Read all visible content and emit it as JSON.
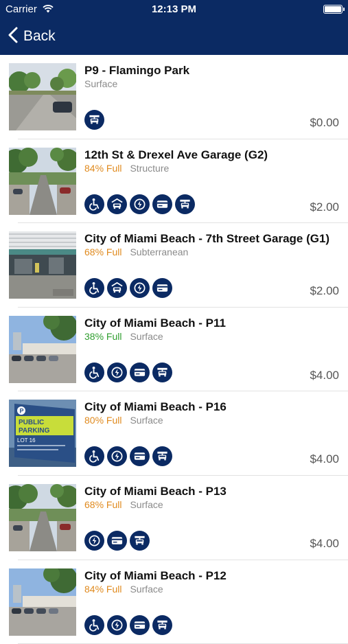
{
  "status_bar": {
    "carrier": "Carrier",
    "time": "12:13 PM"
  },
  "nav": {
    "back_label": "Back"
  },
  "colors": {
    "header": "#0b2a63",
    "orange": "#e08a1e",
    "green": "#2f9e2f",
    "gray": "#8a8a8a"
  },
  "lots": [
    {
      "title": "P9 - Flamingo Park",
      "occupancy": "",
      "occupancy_color": "",
      "type": "Surface",
      "price": "$0.00",
      "amenities": [
        "valet-icon"
      ],
      "photo": "surface-street"
    },
    {
      "title": "12th St & Drexel Ave Garage (G2)",
      "occupancy": "84% Full",
      "occupancy_color": "orange",
      "type": "Structure",
      "price": "$2.00",
      "amenities": [
        "accessible-icon",
        "covered-parking-icon",
        "ev-charging-icon",
        "credit-card-icon",
        "valet-icon"
      ],
      "photo": "tree-street"
    },
    {
      "title": "City of Miami Beach - 7th Street Garage (G1)",
      "occupancy": "68% Full",
      "occupancy_color": "orange",
      "type": "Subterranean",
      "price": "$2.00",
      "amenities": [
        "accessible-icon",
        "covered-parking-icon",
        "ev-charging-icon",
        "credit-card-icon"
      ],
      "photo": "garage"
    },
    {
      "title": "City of Miami Beach - P11",
      "occupancy": "38% Full",
      "occupancy_color": "green",
      "type": "Surface",
      "price": "$4.00",
      "amenities": [
        "accessible-icon",
        "ev-charging-icon",
        "credit-card-icon",
        "valet-icon"
      ],
      "photo": "lot-sky"
    },
    {
      "title": "City of Miami Beach - P16",
      "occupancy": "80% Full",
      "occupancy_color": "orange",
      "type": "Surface",
      "price": "$4.00",
      "amenities": [
        "accessible-icon",
        "ev-charging-icon",
        "credit-card-icon",
        "valet-icon"
      ],
      "photo": "sign"
    },
    {
      "title": "City of Miami Beach - P13",
      "occupancy": "68% Full",
      "occupancy_color": "orange",
      "type": "Surface",
      "price": "$4.00",
      "amenities": [
        "ev-charging-icon",
        "credit-card-icon",
        "valet-icon"
      ],
      "photo": "tree-street"
    },
    {
      "title": "City of Miami Beach - P12",
      "occupancy": "84% Full",
      "occupancy_color": "orange",
      "type": "Surface",
      "price": "",
      "amenities": [
        "accessible-icon",
        "ev-charging-icon",
        "credit-card-icon",
        "valet-icon"
      ],
      "photo": "lot-sky"
    }
  ],
  "photo_sign_text": {
    "line1": "PUBLIC",
    "line2": "PARKING",
    "line3": "LOT 16"
  }
}
